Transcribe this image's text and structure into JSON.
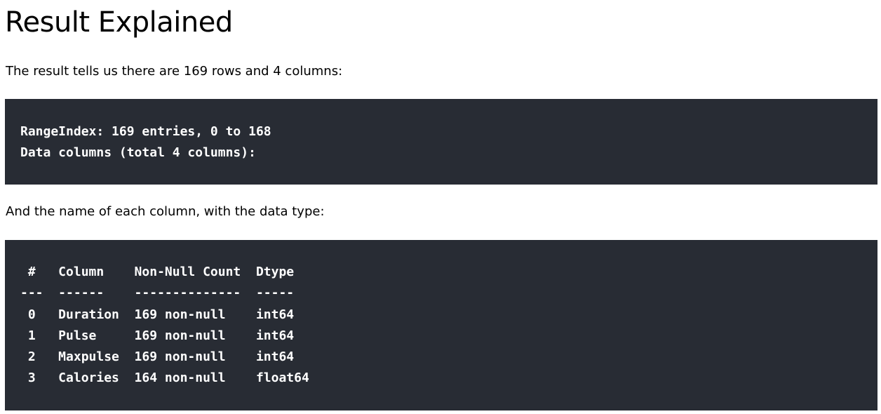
{
  "page": {
    "title": "Result Explained",
    "intro_text": "The result tells us there are 169 rows and 4 columns:",
    "columns_text": "And the name of each column, with the data type:"
  },
  "code_block_1": {
    "lines": [
      "RangeIndex: 169 entries, 0 to 168",
      "Data columns (total 4 columns):"
    ]
  },
  "code_block_2": {
    "lines": [
      " #   Column    Non-Null Count  Dtype",
      "---  ------    --------------  -----",
      " 0   Duration  169 non-null    int64",
      " 1   Pulse     169 non-null    int64",
      " 2   Maxpulse  169 non-null    int64",
      " 3   Calories  164 non-null    float64"
    ]
  }
}
